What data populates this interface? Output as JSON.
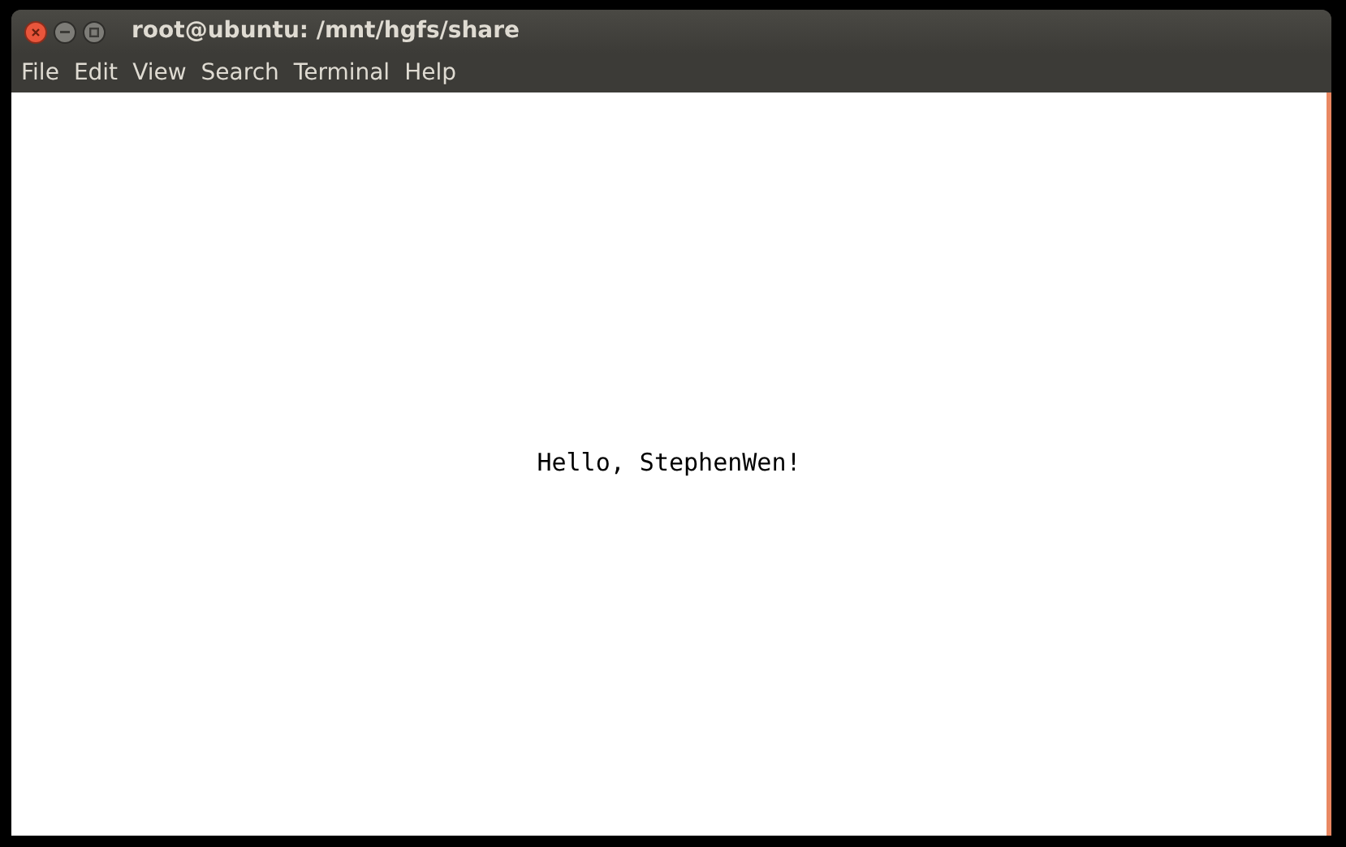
{
  "window": {
    "title": "root@ubuntu: /mnt/hgfs/share"
  },
  "menu": [
    "File",
    "Edit",
    "View",
    "Search",
    "Terminal",
    "Help"
  ],
  "terminal": {
    "output": "Hello, StephenWen!"
  }
}
